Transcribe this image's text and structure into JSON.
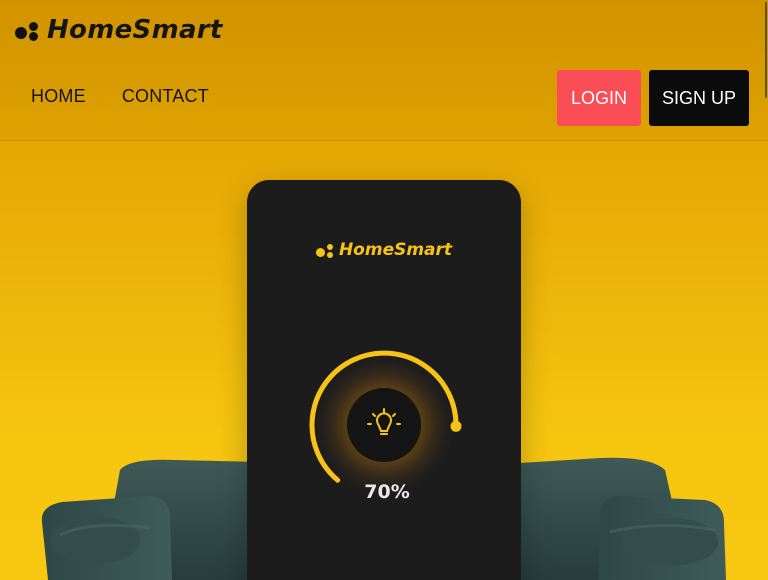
{
  "brand": {
    "name": "HomeSmart",
    "logo_icon": "dots-logo-icon"
  },
  "nav": {
    "items": [
      {
        "label": "HOME"
      },
      {
        "label": "CONTACT"
      }
    ]
  },
  "auth": {
    "login_label": "LOGIN",
    "signup_label": "SIGN UP"
  },
  "phone": {
    "brand_name": "HomeSmart",
    "light_level_percent": 70,
    "light_level_label": "70%",
    "icon": "lightbulb-icon"
  },
  "colors": {
    "accent": "#f8c316",
    "login_button": "#fa4d56",
    "signup_button": "#0b0b0b",
    "phone_body": "#1c1c1c",
    "background": "#f6c510"
  }
}
